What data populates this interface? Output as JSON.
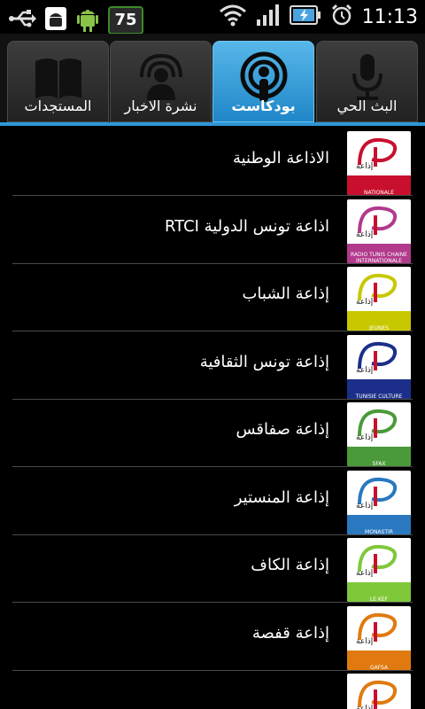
{
  "status_bar": {
    "time": "11:13",
    "battery_level": "75",
    "icons": [
      "usb-icon",
      "android-debug-icon",
      "android-icon",
      "wifi-icon",
      "signal-icon",
      "battery-charging-icon",
      "alarm-clock-icon"
    ]
  },
  "tabs": [
    {
      "label": "البث الحي",
      "icon": "microphone-icon",
      "active": false
    },
    {
      "label": "بودكاست",
      "icon": "podcast-icon",
      "active": true
    },
    {
      "label": "نشرة الاخبار",
      "icon": "broadcast-person-icon",
      "active": false
    },
    {
      "label": "المستجدات",
      "icon": "book-icon",
      "active": false
    }
  ],
  "stations": [
    {
      "name": "الاذاعة الوطنية",
      "logo_sub": "NATIONALE",
      "band_color": "#c8102e"
    },
    {
      "name": "اذاعة تونس الدولية RTCI",
      "logo_sub": "RADIO TUNIS CHAINE INTERNATIONALE",
      "band_color": "#b23a8c"
    },
    {
      "name": "إذاعة الشباب",
      "logo_sub": "JEUNES",
      "band_color": "#c8c800"
    },
    {
      "name": "إذاعة تونس الثقافية",
      "logo_sub": "TUNISIE CULTURE",
      "band_color": "#1b2f8a"
    },
    {
      "name": "إذاعة صفاقس",
      "logo_sub": "SFAX",
      "band_color": "#4b9a3a"
    },
    {
      "name": "إذاعة المنستير",
      "logo_sub": "MONASTIR",
      "band_color": "#2a78c0"
    },
    {
      "name": "إذاعة الكاف",
      "logo_sub": "LE KEF",
      "band_color": "#7fc83a"
    },
    {
      "name": "إذاعة قفصة",
      "logo_sub": "GAFSA",
      "band_color": "#e07a10"
    },
    {
      "name": "",
      "logo_sub": "",
      "band_color": "#e07a10"
    }
  ]
}
